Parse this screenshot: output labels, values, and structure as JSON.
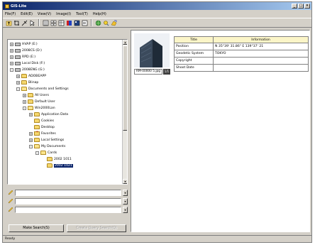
{
  "window": {
    "title": "GIS-Lite"
  },
  "menu": [
    "File(F)",
    "Edit(E)",
    "View(V)",
    "Image(I)",
    "Tool(T)",
    "Help(H)"
  ],
  "toolbar": {
    "icons": [
      "up-folder-icon",
      "crop-tool-icon",
      "select-tool-icon",
      "list-view-icon",
      "grid-view-icon",
      "detail-view-icon",
      "color-icon",
      "thumbnail-icon",
      "globe-icon",
      "search-map-icon",
      "export-icon"
    ]
  },
  "tree": {
    "items": [
      {
        "label": "HVAP (E:)",
        "depth": 0,
        "exp": "+",
        "icon": "drive"
      },
      {
        "label": "2008CS (D:)",
        "depth": 0,
        "exp": "+",
        "icon": "drive"
      },
      {
        "label": "RPD (E:)",
        "depth": 0,
        "exp": "+",
        "icon": "drive"
      },
      {
        "label": "Local Disk (F:)",
        "depth": 0,
        "exp": "+",
        "icon": "drive"
      },
      {
        "label": "2008ENG (G:)",
        "depth": 0,
        "exp": "-",
        "icon": "drive"
      },
      {
        "label": "ADOBEAPP",
        "depth": 1,
        "exp": "+",
        "icon": "folder"
      },
      {
        "label": "Blinap",
        "depth": 1,
        "exp": "+",
        "icon": "folder"
      },
      {
        "label": "Documents and Settings",
        "depth": 1,
        "exp": "-",
        "icon": "folder"
      },
      {
        "label": "All Users",
        "depth": 2,
        "exp": "+",
        "icon": "folder"
      },
      {
        "label": "Default User",
        "depth": 2,
        "exp": "+",
        "icon": "folder"
      },
      {
        "label": "Win2000Lan",
        "depth": 2,
        "exp": "-",
        "icon": "folder"
      },
      {
        "label": "Application Data",
        "depth": 3,
        "exp": "+",
        "icon": "folder"
      },
      {
        "label": "Cookies",
        "depth": 3,
        "exp": "",
        "icon": "folder"
      },
      {
        "label": "Desktop",
        "depth": 3,
        "exp": "",
        "icon": "folder"
      },
      {
        "label": "Favorites",
        "depth": 3,
        "exp": "+",
        "icon": "fav"
      },
      {
        "label": "Local Settings",
        "depth": 3,
        "exp": "+",
        "icon": "folder"
      },
      {
        "label": "My Documents",
        "depth": 3,
        "exp": "-",
        "icon": "folder"
      },
      {
        "label": "Cards",
        "depth": 4,
        "exp": "-",
        "icon": "folder"
      },
      {
        "label": "2002 1011",
        "depth": 5,
        "exp": "",
        "icon": "folder"
      },
      {
        "label": "2002 1021",
        "depth": 5,
        "exp": "",
        "icon": "folder",
        "selected": true
      }
    ]
  },
  "search_fields": [
    {
      "value": ""
    },
    {
      "value": ""
    },
    {
      "value": ""
    }
  ],
  "buttons": {
    "make_search": "Make Search(S)",
    "create_query": "Create Query Search(Q)"
  },
  "thumbnail": {
    "filename": "RM-00000 5.jpg",
    "badge": "1/1"
  },
  "info_table": {
    "headers": [
      "Title",
      "Information"
    ],
    "rows": [
      {
        "title": "Position",
        "info": "N 35°39' 31.86\" E 139°37' 21"
      },
      {
        "title": "Geodetic System",
        "info": "TOKYO"
      },
      {
        "title": "Copyright",
        "info": ""
      },
      {
        "title": "Shoot Date",
        "info": ""
      }
    ]
  },
  "status": {
    "text": "Ready"
  },
  "colors": {
    "title_start": "#0a246a",
    "title_end": "#a6caf0",
    "selection": "#0a246a",
    "table_header": "#fbf5c8"
  }
}
